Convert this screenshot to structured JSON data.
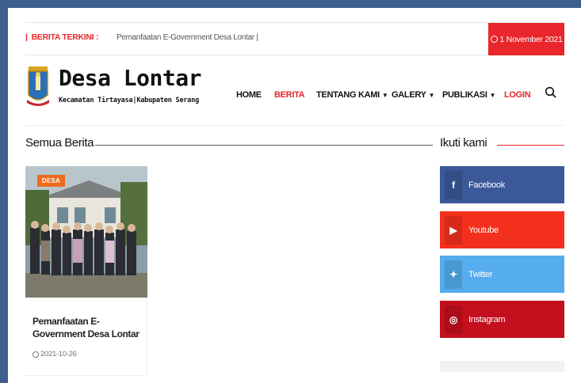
{
  "ticker": {
    "label": "BERITA TERKINI :",
    "headline": "Pemanfaatan E-Government Desa Lontar |",
    "date": "1 November 2021"
  },
  "header": {
    "site_title": "Desa Lontar",
    "site_subtitle": "Kecamatan Tirtayasa|Kabupaten Serang",
    "nav": [
      {
        "label": "HOME"
      },
      {
        "label": "BERITA"
      },
      {
        "label": "TENTANG KAMI"
      },
      {
        "label": "GALERY"
      },
      {
        "label": "PUBLIKASI"
      },
      {
        "label": "LOGIN"
      }
    ]
  },
  "main": {
    "section_title": "Semua Berita",
    "posts": [
      {
        "category": "DESA",
        "title": "Pemanfaatan E-Government Desa Lontar",
        "date": "2021-10-26"
      }
    ]
  },
  "sidebar": {
    "title": "Ikuti kami",
    "social": [
      {
        "label": "Facebook",
        "icon": "facebook-icon",
        "color": "#3b5998"
      },
      {
        "label": "Youtube",
        "icon": "youtube-icon",
        "color": "#f3301e"
      },
      {
        "label": "Twitter",
        "icon": "twitter-icon",
        "color": "#55acee"
      },
      {
        "label": "Instagram",
        "icon": "instagram-icon",
        "color": "#c30f1e"
      }
    ]
  },
  "colors": {
    "accent": "#e8262c",
    "category_badge": "#ee6a1c",
    "frame": "#3e5e8c"
  }
}
